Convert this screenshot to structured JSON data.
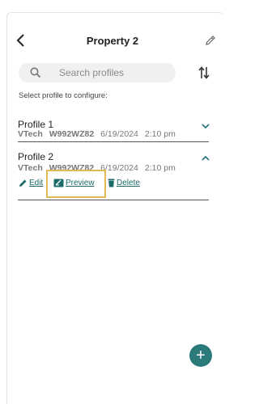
{
  "header": {
    "title": "Property 2"
  },
  "search": {
    "placeholder": "Search profiles"
  },
  "hint": "Select profile to configure:",
  "profiles": [
    {
      "name": "Profile 1",
      "brand": "VTech",
      "model": "W992WZ82",
      "date": "6/19/2024",
      "time": "2:10 pm",
      "expanded": false
    },
    {
      "name": "Profile 2",
      "brand": "VTech",
      "model": "W992WZ82",
      "date": "6/19/2024",
      "time": "2:10 pm",
      "expanded": true
    }
  ],
  "actions": {
    "edit": "Edit",
    "preview": "Preview",
    "delete": "Delete"
  },
  "fab": {
    "label": "+"
  },
  "colors": {
    "accent": "#2c7a7b",
    "highlight": "#e3b956"
  }
}
